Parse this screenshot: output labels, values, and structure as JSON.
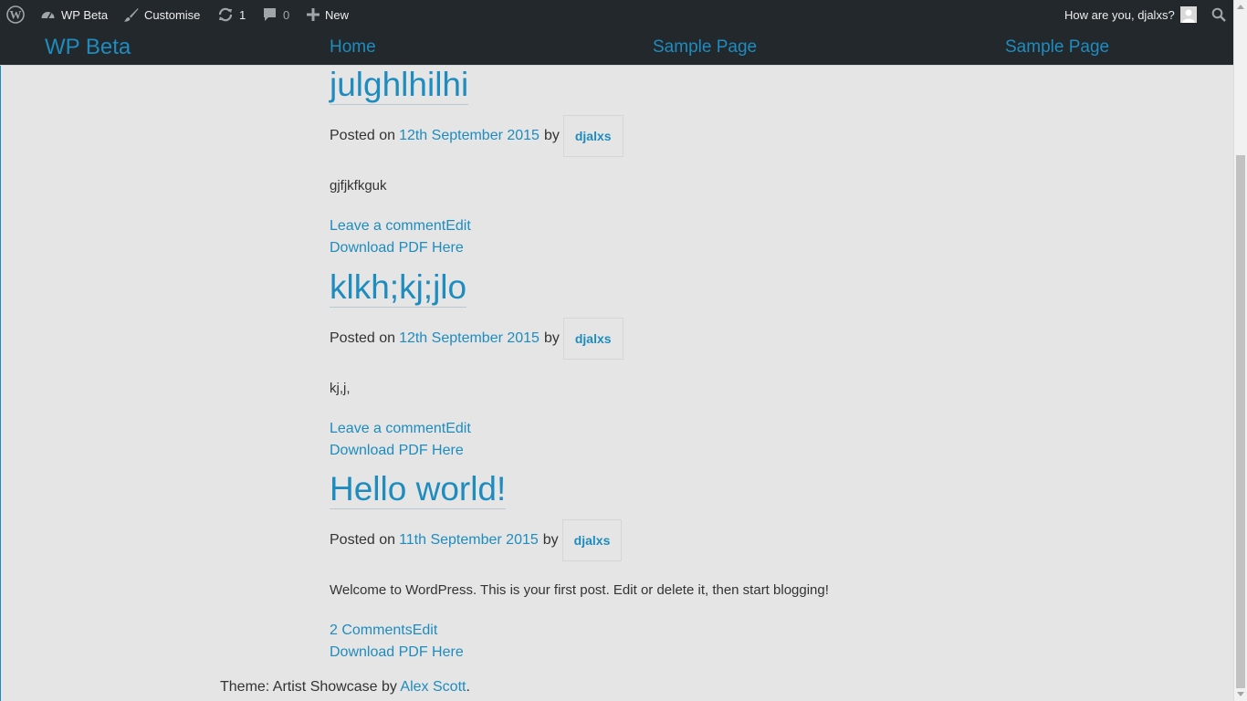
{
  "adminbar": {
    "site_name": "WP Beta",
    "customise": "Customise",
    "updates_count": "1",
    "comments_count": "0",
    "new_label": "New",
    "greeting": "How are you, djalxs?"
  },
  "header": {
    "site_title": "WP Beta",
    "nav": [
      "Home",
      "Sample Page",
      "Sample Page"
    ]
  },
  "posts": [
    {
      "title": "julghlhilhi",
      "posted_on": "Posted on",
      "date": "12th September 2015",
      "by": "by",
      "author": "djalxs",
      "excerpt": "gjfjkfkguk",
      "comment_link": "Leave a comment",
      "edit_link": "Edit",
      "pdf_link": "Download PDF Here"
    },
    {
      "title": "klkh;kj;jlo",
      "posted_on": "Posted on",
      "date": "12th September 2015",
      "by": "by",
      "author": "djalxs",
      "excerpt": "kj,j,",
      "comment_link": "Leave a comment",
      "edit_link": "Edit",
      "pdf_link": "Download PDF Here"
    },
    {
      "title": "Hello world!",
      "posted_on": "Posted on",
      "date": "11th September 2015",
      "by": "by",
      "author": "djalxs",
      "excerpt": "Welcome to WordPress. This is your first post. Edit or delete it, then start blogging!",
      "comment_link": "2 Comments",
      "edit_link": "Edit",
      "pdf_link": "Download PDF Here"
    }
  ],
  "footer": {
    "text_before": "Theme: Artist Showcase by ",
    "author_link": "Alex Scott",
    "text_after": "."
  },
  "colors": {
    "adminbar_bg": "#23282d",
    "link": "#1e8cbe",
    "page_bg": "#e5e5e5"
  }
}
